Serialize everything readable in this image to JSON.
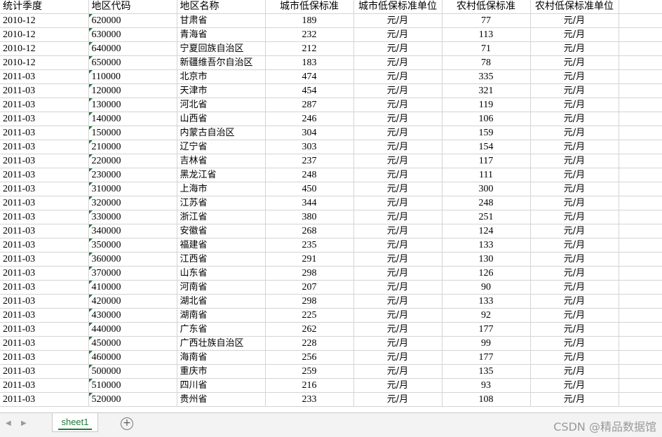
{
  "sheet": {
    "headers": [
      "统计季度",
      "地区代码",
      "地区名称",
      "城市低保标准",
      "城市低保标准单位",
      "农村低保标准",
      "农村低保标准单位"
    ],
    "rows": [
      [
        "2010-12",
        "620000",
        "甘肃省",
        "189",
        "元/月",
        "77",
        "元/月"
      ],
      [
        "2010-12",
        "630000",
        "青海省",
        "232",
        "元/月",
        "113",
        "元/月"
      ],
      [
        "2010-12",
        "640000",
        "宁夏回族自治区",
        "212",
        "元/月",
        "71",
        "元/月"
      ],
      [
        "2010-12",
        "650000",
        "新疆维吾尔自治区",
        "183",
        "元/月",
        "78",
        "元/月"
      ],
      [
        "2011-03",
        "110000",
        "北京市",
        "474",
        "元/月",
        "335",
        "元/月"
      ],
      [
        "2011-03",
        "120000",
        "天津市",
        "454",
        "元/月",
        "321",
        "元/月"
      ],
      [
        "2011-03",
        "130000",
        "河北省",
        "287",
        "元/月",
        "119",
        "元/月"
      ],
      [
        "2011-03",
        "140000",
        "山西省",
        "246",
        "元/月",
        "106",
        "元/月"
      ],
      [
        "2011-03",
        "150000",
        "内蒙古自治区",
        "304",
        "元/月",
        "159",
        "元/月"
      ],
      [
        "2011-03",
        "210000",
        "辽宁省",
        "303",
        "元/月",
        "154",
        "元/月"
      ],
      [
        "2011-03",
        "220000",
        "吉林省",
        "237",
        "元/月",
        "117",
        "元/月"
      ],
      [
        "2011-03",
        "230000",
        "黑龙江省",
        "248",
        "元/月",
        "111",
        "元/月"
      ],
      [
        "2011-03",
        "310000",
        "上海市",
        "450",
        "元/月",
        "300",
        "元/月"
      ],
      [
        "2011-03",
        "320000",
        "江苏省",
        "344",
        "元/月",
        "248",
        "元/月"
      ],
      [
        "2011-03",
        "330000",
        "浙江省",
        "380",
        "元/月",
        "251",
        "元/月"
      ],
      [
        "2011-03",
        "340000",
        "安徽省",
        "268",
        "元/月",
        "124",
        "元/月"
      ],
      [
        "2011-03",
        "350000",
        "福建省",
        "235",
        "元/月",
        "133",
        "元/月"
      ],
      [
        "2011-03",
        "360000",
        "江西省",
        "291",
        "元/月",
        "130",
        "元/月"
      ],
      [
        "2011-03",
        "370000",
        "山东省",
        "298",
        "元/月",
        "126",
        "元/月"
      ],
      [
        "2011-03",
        "410000",
        "河南省",
        "207",
        "元/月",
        "90",
        "元/月"
      ],
      [
        "2011-03",
        "420000",
        "湖北省",
        "298",
        "元/月",
        "133",
        "元/月"
      ],
      [
        "2011-03",
        "430000",
        "湖南省",
        "225",
        "元/月",
        "92",
        "元/月"
      ],
      [
        "2011-03",
        "440000",
        "广东省",
        "262",
        "元/月",
        "177",
        "元/月"
      ],
      [
        "2011-03",
        "450000",
        "广西壮族自治区",
        "228",
        "元/月",
        "99",
        "元/月"
      ],
      [
        "2011-03",
        "460000",
        "海南省",
        "256",
        "元/月",
        "177",
        "元/月"
      ],
      [
        "2011-03",
        "500000",
        "重庆市",
        "259",
        "元/月",
        "135",
        "元/月"
      ],
      [
        "2011-03",
        "510000",
        "四川省",
        "216",
        "元/月",
        "93",
        "元/月"
      ],
      [
        "2011-03",
        "520000",
        "贵州省",
        "233",
        "元/月",
        "108",
        "元/月"
      ]
    ]
  },
  "tabs": {
    "active": "sheet1"
  },
  "watermark": "CSDN @精品数据馆",
  "colors": {
    "accent": "#1e7a3a",
    "gridline": "#d4d4d4"
  },
  "icons": {
    "prev": "chevron-left-icon",
    "next": "chevron-right-icon",
    "add": "plus-circle-icon"
  }
}
